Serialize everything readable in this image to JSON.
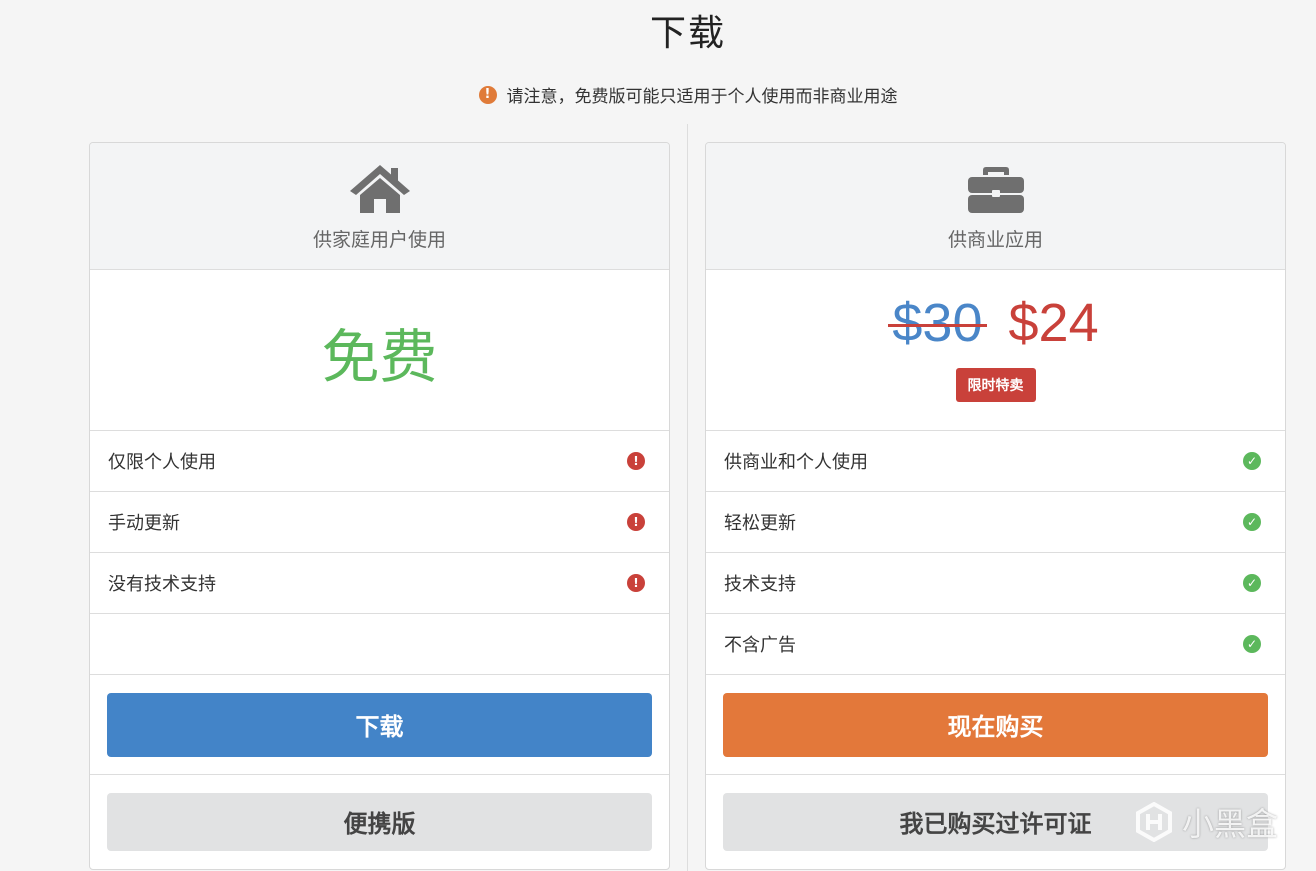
{
  "page": {
    "title": "下载",
    "notice": "请注意，免费版可能只适用于个人使用而非商业用途"
  },
  "home_plan": {
    "icon": "house-icon",
    "label": "供家庭用户使用",
    "price": "免费",
    "features": [
      {
        "text": "仅限个人使用",
        "status": "warning"
      },
      {
        "text": "手动更新",
        "status": "warning"
      },
      {
        "text": "没有技术支持",
        "status": "warning"
      }
    ],
    "primary_button": "下载",
    "secondary_button": "便携版"
  },
  "business_plan": {
    "icon": "briefcase-icon",
    "label": "供商业应用",
    "old_price": "$30",
    "new_price": "$24",
    "badge": "限时特卖",
    "features": [
      {
        "text": "供商业和个人使用",
        "status": "check"
      },
      {
        "text": "轻松更新",
        "status": "check"
      },
      {
        "text": "技术支持",
        "status": "check"
      },
      {
        "text": "不含广告",
        "status": "check"
      }
    ],
    "primary_button": "现在购买",
    "secondary_button": "我已购买过许可证"
  },
  "watermark": "小黑盒",
  "colors": {
    "free_green": "#5cb85c",
    "sale_red": "#c9413a",
    "download_blue": "#4384c8",
    "buy_orange": "#e3783a"
  }
}
